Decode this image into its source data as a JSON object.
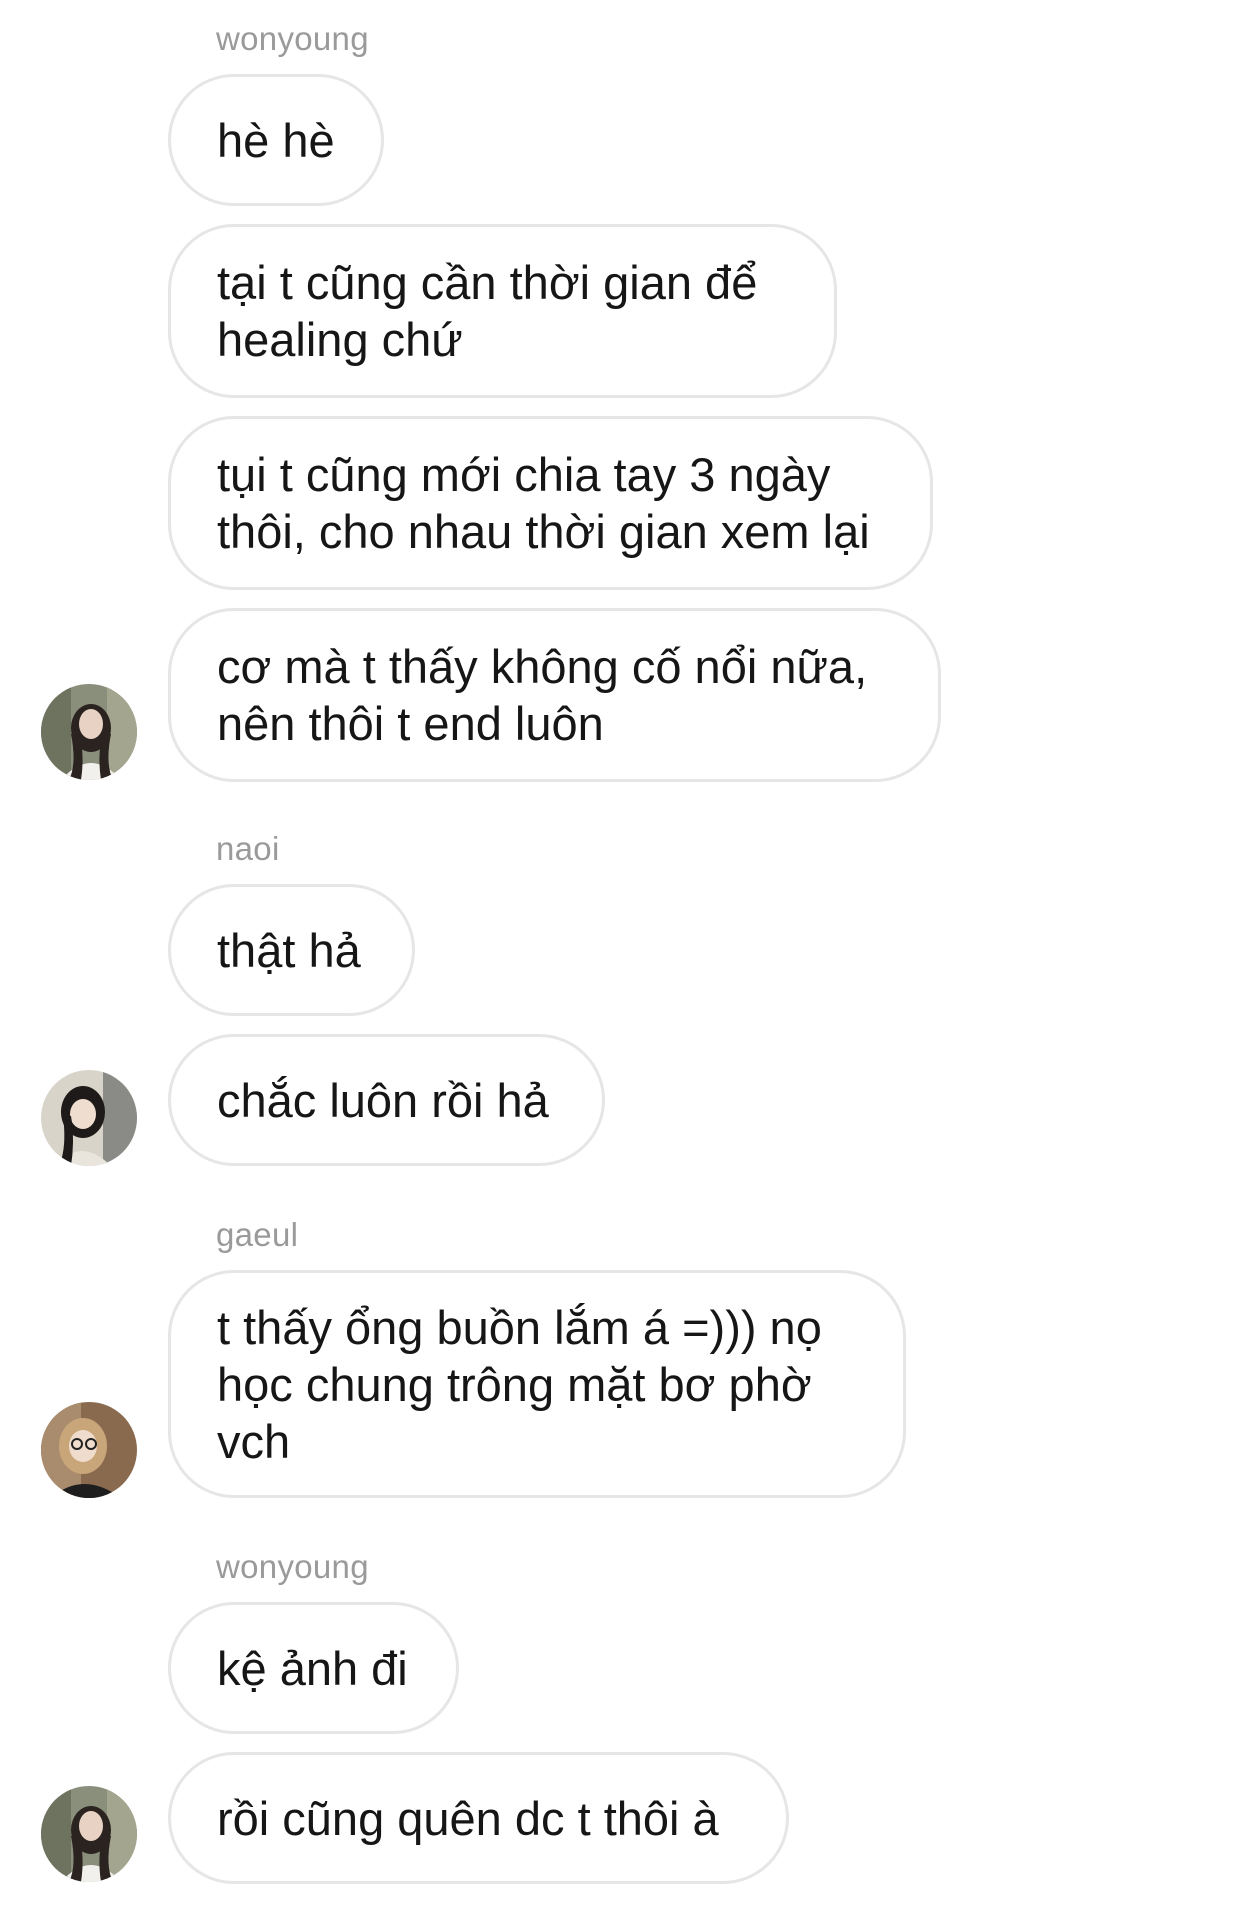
{
  "messages": {
    "group1": {
      "sender": "wonyoung",
      "bubbles": [
        "hè hè",
        "tại t cũng cần thời gian để\nhealing chứ",
        "tụi t cũng mới chia tay 3 ngày\nthôi, cho nhau thời gian xem lại",
        "cơ mà t thấy không cố nổi nữa,\nnên thôi t end luôn"
      ],
      "avatar_icon": "avatar-wonyoung"
    },
    "group2": {
      "sender": "naoi",
      "bubbles": [
        "thật hả",
        "chắc luôn rồi hả"
      ],
      "avatar_icon": "avatar-naoi"
    },
    "group3": {
      "sender": "gaeul",
      "bubbles": [
        "t thấy ổng buồn lắm á =))) nọ\nhọc chung trông mặt bơ phờ\nvch"
      ],
      "avatar_icon": "avatar-gaeul"
    },
    "group4": {
      "sender": "wonyoung",
      "bubbles": [
        "kệ ảnh đi",
        "rồi cũng quên dc t thôi à"
      ],
      "avatar_icon": "avatar-wonyoung"
    }
  },
  "colors": {
    "bubble_border": "#e6e6e6",
    "sender_text": "#9a9a9a",
    "message_text": "#161616",
    "background": "#ffffff"
  }
}
